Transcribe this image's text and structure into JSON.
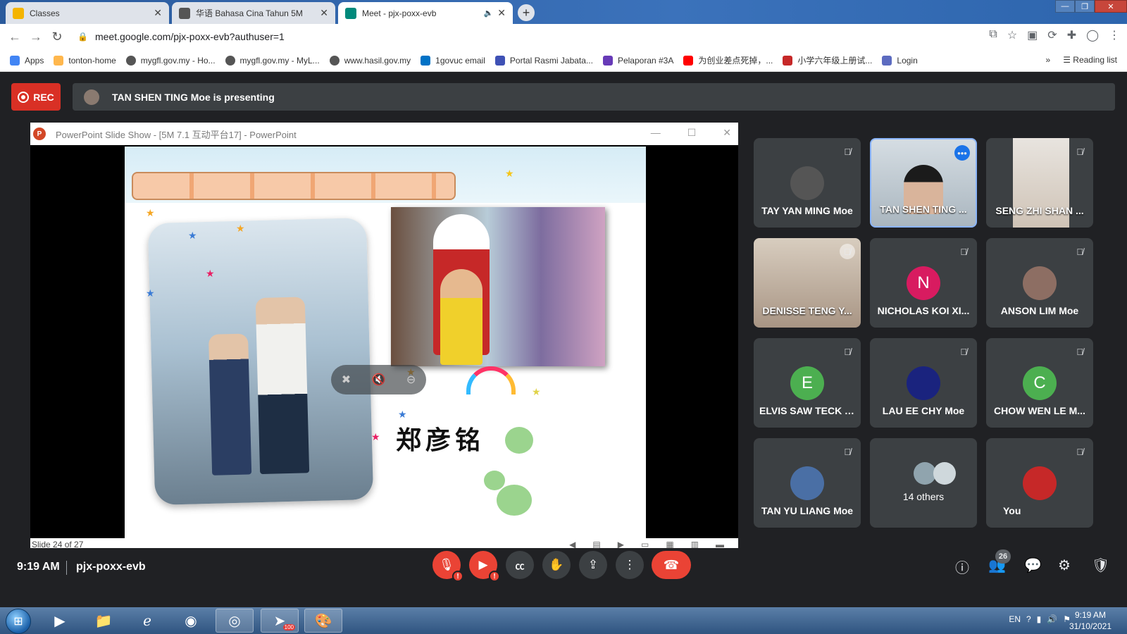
{
  "browser": {
    "tabs": [
      {
        "title": "Classes",
        "icon": "google-classroom-icon",
        "color": "#f4b400"
      },
      {
        "title": "华语 Bahasa Cina Tahun 5M",
        "icon": "classroom-icon",
        "color": "#333333"
      },
      {
        "title": "Meet - pjx-poxx-evb",
        "icon": "google-meet-icon",
        "color": "#00897b"
      }
    ],
    "url": "meet.google.com/pjx-poxx-evb?authuser=1",
    "bookmarks": [
      {
        "label": "Apps",
        "color": "#4285f4"
      },
      {
        "label": "tonton-home",
        "color": "#ffb74d"
      },
      {
        "label": "mygfl.gov.my - Ho...",
        "color": "#555555"
      },
      {
        "label": "mygfl.gov.my - MyL...",
        "color": "#555555"
      },
      {
        "label": "www.hasil.gov.my",
        "color": "#555555"
      },
      {
        "label": "1govuc email",
        "color": "#0072c6"
      },
      {
        "label": "Portal Rasmi Jabata...",
        "color": "#3f51b5"
      },
      {
        "label": "Pelaporan #3A",
        "color": "#673ab7"
      },
      {
        "label": "为创业差点死掉，...",
        "color": "#ff0000"
      },
      {
        "label": "小学六年级上册试...",
        "color": "#c62828"
      },
      {
        "label": "Login",
        "color": "#5c6bc0"
      }
    ],
    "reading_list": "Reading list"
  },
  "meet": {
    "rec_label": "REC",
    "presenting_text": "TAN SHEN TING Moe is presenting",
    "ppt_title": "PowerPoint Slide Show - [5M 7.1 互动平台17] - PowerPoint",
    "slide_status": "Slide 24 of 27",
    "slide_name_text": "郑彦铭",
    "participants": [
      {
        "name": "TAY YAN MING Moe",
        "initial": "",
        "color": "#555555",
        "video": false
      },
      {
        "name": "TAN SHEN TING ...",
        "initial": "",
        "color": "#cfd8dc",
        "video": true
      },
      {
        "name": "SENG ZHI SHAN ...",
        "initial": "",
        "color": "#e0d6cf",
        "video": true
      },
      {
        "name": "DENISSE TENG Y...",
        "initial": "",
        "color": "#c8b8a6",
        "video": true
      },
      {
        "name": "NICHOLAS KOI XI...",
        "initial": "N",
        "color": "#d81b60",
        "video": false
      },
      {
        "name": "ANSON LIM Moe",
        "initial": "",
        "color": "#8d6e63",
        "video": false
      },
      {
        "name": "ELVIS SAW TECK Y...",
        "initial": "E",
        "color": "#4caf50",
        "video": false
      },
      {
        "name": "LAU EE CHY Moe",
        "initial": "",
        "color": "#1a237e",
        "video": false
      },
      {
        "name": "CHOW WEN LE M...",
        "initial": "C",
        "color": "#4caf50",
        "video": false
      },
      {
        "name": "TAN YU LIANG Moe",
        "initial": "",
        "color": "#4a6fa5",
        "video": false
      },
      {
        "name": "14 others",
        "initial": "",
        "color": "#90a4ae",
        "video": false
      },
      {
        "name": "You",
        "initial": "",
        "color": "#c62828",
        "video": false
      }
    ],
    "time": "9:19 AM",
    "meeting_code": "pjx-poxx-evb",
    "participant_count": "26"
  },
  "taskbar": {
    "lang": "EN",
    "time": "9:19 AM",
    "date": "31/10/2021",
    "telegram_badge": "100"
  }
}
